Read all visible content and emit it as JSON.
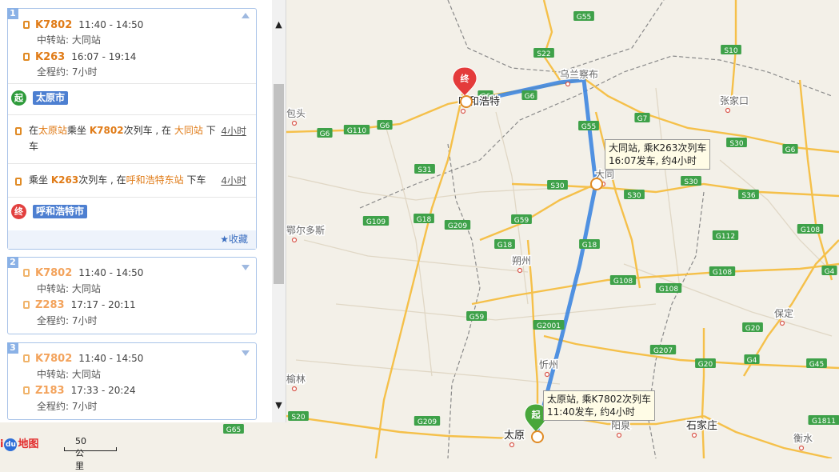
{
  "map": {
    "cities": [
      {
        "id": "hohhot",
        "name": "呼和浩特",
        "big": true
      },
      {
        "id": "baotou",
        "name": "包头",
        "big": false
      },
      {
        "id": "ulanqab",
        "name": "乌兰察布",
        "big": false
      },
      {
        "id": "zhangjiakou",
        "name": "张家口",
        "big": false
      },
      {
        "id": "datong",
        "name": "大同",
        "big": false
      },
      {
        "id": "ordos",
        "name": "鄂尔多斯",
        "big": false
      },
      {
        "id": "shuozhou",
        "name": "朔州",
        "big": false
      },
      {
        "id": "xinzhou",
        "name": "忻州",
        "big": false
      },
      {
        "id": "yulin",
        "name": "榆林",
        "big": false
      },
      {
        "id": "taiyuan",
        "name": "太原",
        "big": true
      },
      {
        "id": "yangquan",
        "name": "阳泉",
        "big": false
      },
      {
        "id": "shijiazhuang",
        "name": "石家庄",
        "big": true
      },
      {
        "id": "baoding",
        "name": "保定",
        "big": false
      },
      {
        "id": "hengshui",
        "name": "衡水",
        "big": false
      }
    ],
    "highways": [
      {
        "id": "g55a",
        "label": "G55"
      },
      {
        "id": "s22",
        "label": "S22"
      },
      {
        "id": "s10",
        "label": "S10"
      },
      {
        "id": "g6a",
        "label": "G6"
      },
      {
        "id": "g6b",
        "label": "G6"
      },
      {
        "id": "g6c",
        "label": "G6"
      },
      {
        "id": "g6d",
        "label": "G6"
      },
      {
        "id": "g110",
        "label": "G110"
      },
      {
        "id": "g55b",
        "label": "G55"
      },
      {
        "id": "g7",
        "label": "G7"
      },
      {
        "id": "s30a",
        "label": "S30"
      },
      {
        "id": "g6e",
        "label": "G6"
      },
      {
        "id": "s31",
        "label": "S31"
      },
      {
        "id": "s30b",
        "label": "S30"
      },
      {
        "id": "s30c",
        "label": "S30"
      },
      {
        "id": "s30d",
        "label": "S30"
      },
      {
        "id": "s36",
        "label": "S36"
      },
      {
        "id": "g109",
        "label": "G109"
      },
      {
        "id": "g18a",
        "label": "G18"
      },
      {
        "id": "g209a",
        "label": "G209"
      },
      {
        "id": "g59a",
        "label": "G59"
      },
      {
        "id": "g112",
        "label": "G112"
      },
      {
        "id": "g108a",
        "label": "G108"
      },
      {
        "id": "g18b",
        "label": "G18"
      },
      {
        "id": "g18c",
        "label": "G18"
      },
      {
        "id": "g108b",
        "label": "G108"
      },
      {
        "id": "g108c",
        "label": "G108"
      },
      {
        "id": "g108d",
        "label": "G108"
      },
      {
        "id": "g4a",
        "label": "G4"
      },
      {
        "id": "g59b",
        "label": "G59"
      },
      {
        "id": "g2001",
        "label": "G2001"
      },
      {
        "id": "g20a",
        "label": "G20"
      },
      {
        "id": "g207",
        "label": "G207"
      },
      {
        "id": "g20b",
        "label": "G20"
      },
      {
        "id": "g4b",
        "label": "G4"
      },
      {
        "id": "g45",
        "label": "G45"
      },
      {
        "id": "s20",
        "label": "S20"
      },
      {
        "id": "g209b",
        "label": "G209"
      },
      {
        "id": "g1811",
        "label": "G1811"
      },
      {
        "id": "g65",
        "label": "G65"
      }
    ],
    "marker_end": "终",
    "marker_start": "起",
    "callout_datong": [
      "大同站, 乘K263次列车",
      "16:07发车, 约4小时"
    ],
    "callout_taiyuan": [
      "太原站, 乘K7802次列车",
      "11:40发车, 约4小时"
    ],
    "colors": {
      "route": "#3e86e0",
      "highway_badge": "#3ea149",
      "expressway": "#f5c04a"
    }
  },
  "panel": {
    "route1": {
      "index": "1",
      "train1": "K7802",
      "time1": "11:40 - 14:50",
      "transfer": "中转站: 大同站",
      "train2": "K263",
      "time2": "16:07 - 19:14",
      "total": "全程约: 7小时",
      "start_badge": "起",
      "start_place": "太原市",
      "step1": {
        "pre": "在",
        "station": "太原站",
        "mid": "乘坐",
        "train": "K7802",
        "post": "次列车 , 在",
        "station2": "大同站",
        "end": "下车",
        "duration": "4小时"
      },
      "step2": {
        "pre": "乘坐",
        "train": "K263",
        "mid": "次列车 , 在",
        "station": "呼和浩特东站",
        "end": "下车",
        "duration": "4小时"
      },
      "end_badge": "终",
      "end_place": "呼和浩特市",
      "favorite": "收藏"
    },
    "route2": {
      "index": "2",
      "train1": "K7802",
      "time1": "11:40 - 14:50",
      "transfer": "中转站: 大同站",
      "train2": "Z283",
      "time2": "17:17 - 20:11",
      "total": "全程约: 7小时"
    },
    "route3": {
      "index": "3",
      "train1": "K7802",
      "time1": "11:40 - 14:50",
      "transfer": "中转站: 大同站",
      "train2": "Z183",
      "time2": "17:33 - 20:24",
      "total": "全程约: 7小时"
    }
  },
  "footer": {
    "logo_text": "i du 地图",
    "scale": "50 公里"
  }
}
